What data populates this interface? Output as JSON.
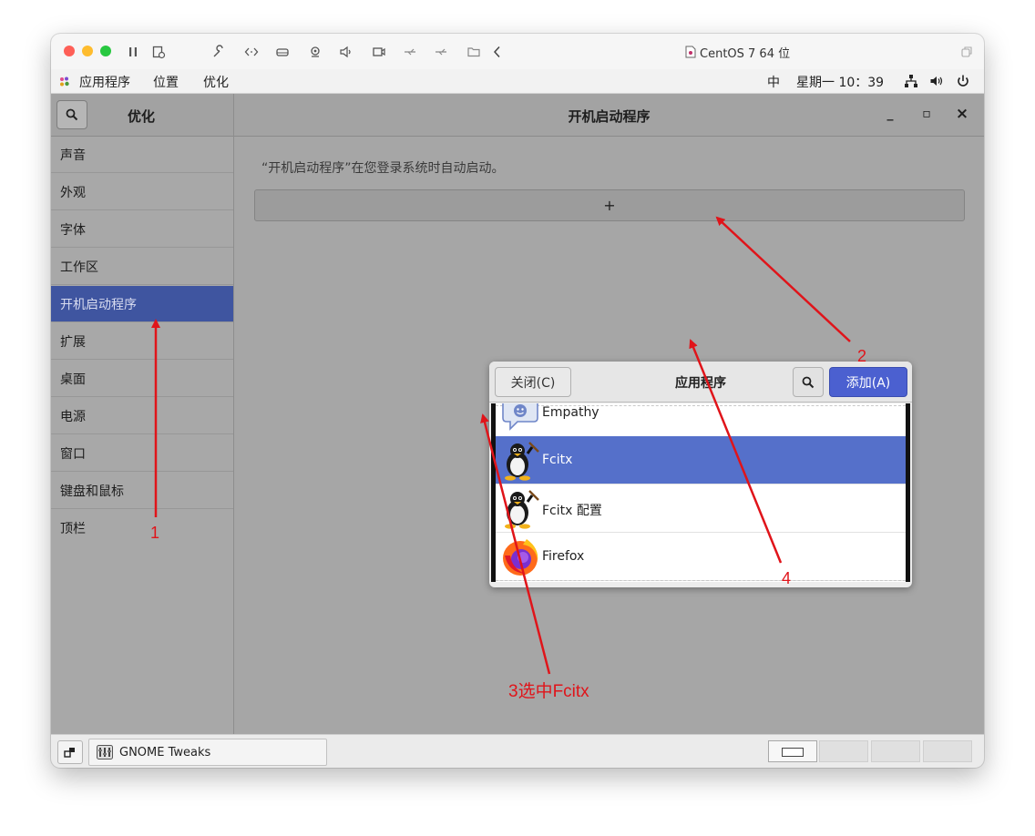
{
  "mac_window": {
    "title": "CentOS 7 64 位",
    "lights": [
      "#fe5f57",
      "#febc2e",
      "#28c840"
    ]
  },
  "gnome_topbar": {
    "apps_menu": "应用程序",
    "places_menu": "位置",
    "current_app": "优化",
    "input_method": "中",
    "clock": "星期一 10：39"
  },
  "sidebar": {
    "title": "优化",
    "items": [
      {
        "label": "声音"
      },
      {
        "label": "外观"
      },
      {
        "label": "字体"
      },
      {
        "label": "工作区"
      },
      {
        "label": "开机启动程序",
        "active": true
      },
      {
        "label": "扩展"
      },
      {
        "label": "桌面"
      },
      {
        "label": "电源"
      },
      {
        "label": "窗口"
      },
      {
        "label": "键盘和鼠标"
      },
      {
        "label": "顶栏"
      }
    ]
  },
  "main": {
    "title": "开机启动程序",
    "description": "“开机启动程序”在您登录系统时自动启动。",
    "add_button": "+",
    "minimize": "_",
    "maximize": "▫",
    "close": "×"
  },
  "dialog": {
    "close_button": "关闭(C)",
    "title": "应用程序",
    "add_button": "添加(A)",
    "apps": [
      {
        "name": "Empathy",
        "icon": "empathy-icon"
      },
      {
        "name": "Fcitx",
        "icon": "penguin-icon",
        "selected": true
      },
      {
        "name": "Fcitx 配置",
        "icon": "penguin-icon"
      },
      {
        "name": "Firefox",
        "icon": "firefox-icon"
      }
    ]
  },
  "taskbar": {
    "task_label": "GNOME Tweaks"
  },
  "annotations": {
    "color": "#e0141a",
    "labels": [
      "1",
      "2",
      "3选中Fcitx",
      "4"
    ]
  }
}
